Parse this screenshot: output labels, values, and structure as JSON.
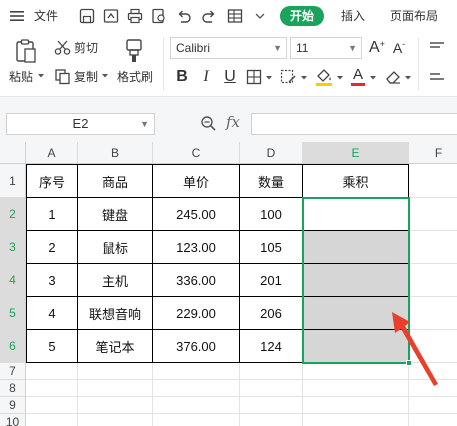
{
  "menu": {
    "hamburger_label": "文件",
    "tabs": [
      "开始",
      "插入",
      "页面布局"
    ],
    "active_tab_index": 0
  },
  "ribbon": {
    "paste_label": "粘贴",
    "cut_label": "剪切",
    "copy_label": "复制",
    "format_painter_label": "格式刷",
    "font_name": "Calibri",
    "font_size": "11",
    "bold_label": "B",
    "italic_label": "I",
    "underline_label": "U",
    "font_color_label": "A",
    "grow_font_label": "A",
    "shrink_font_label": "A"
  },
  "formula_bar": {
    "name_box": "E2",
    "fx_label": "fx",
    "formula": ""
  },
  "grid": {
    "columns": [
      "A",
      "B",
      "C",
      "D",
      "E",
      "F"
    ],
    "selected_column": "E",
    "row_numbers": [
      "1",
      "2",
      "3",
      "4",
      "5",
      "6",
      "7",
      "8",
      "9",
      "10"
    ],
    "selected_rows": [
      "2",
      "3",
      "4",
      "5",
      "6"
    ],
    "header_row": [
      "序号",
      "商品",
      "单价",
      "数量",
      "乘积"
    ],
    "rows": [
      [
        "1",
        "键盘",
        "245.00",
        "100",
        ""
      ],
      [
        "2",
        "鼠标",
        "123.00",
        "105",
        ""
      ],
      [
        "3",
        "主机",
        "336.00",
        "201",
        ""
      ],
      [
        "4",
        "联想音响",
        "229.00",
        "206",
        ""
      ],
      [
        "5",
        "笔记本",
        "376.00",
        "124",
        ""
      ]
    ],
    "selection_range": "E2:E6",
    "selection_color": "#1aa35c"
  },
  "colors": {
    "accent": "#1aa35c",
    "shaded_cell": "#d6d6d6",
    "arrow": "#e8402c"
  }
}
